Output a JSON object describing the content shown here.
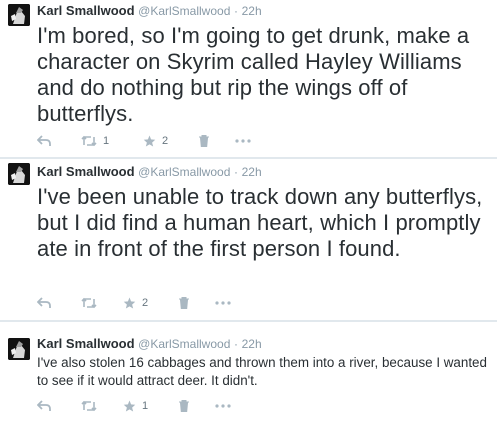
{
  "tweets": [
    {
      "author": "Karl Smallwood",
      "handle": "@KarlSmallwood",
      "separator": "·",
      "time": "22h",
      "text": "I'm bored, so I'm going to get drunk, make a character on Skyrim called Hayley Williams and do nothing but rip the wings off of butterflys.",
      "retweets": "1",
      "favorites": "2"
    },
    {
      "author": "Karl Smallwood",
      "handle": "@KarlSmallwood",
      "separator": "·",
      "time": "22h",
      "text": "I've been unable to track down any butterflys, but I did find a human heart, which I promptly ate in front of the first person I found.",
      "retweets": "",
      "favorites": "2"
    },
    {
      "author": "Karl Smallwood",
      "handle": "@KarlSmallwood",
      "separator": "·",
      "time": "22h",
      "text": "I've also stolen 16 cabbages and thrown them into a river, because I wanted to see if it would attract deer. It didn't.",
      "retweets": "",
      "favorites": "1"
    }
  ],
  "icons": {
    "reply": "reply-icon",
    "retweet": "retweet-icon",
    "favorite": "star-icon",
    "delete": "trash-icon",
    "more": "more-icon"
  },
  "colors": {
    "text": "#292f33",
    "meta": "#8899a6",
    "icon": "#aab8c2",
    "divider": "#e1e8ed"
  }
}
